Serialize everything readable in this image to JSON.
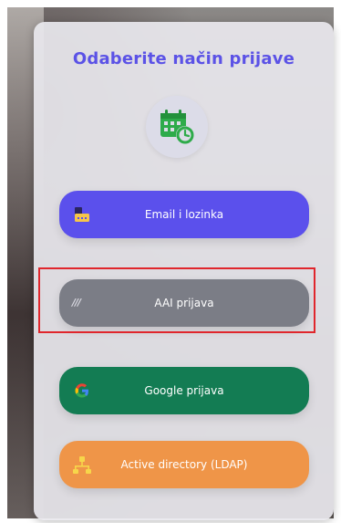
{
  "login": {
    "title": "Odaberite način prijave",
    "options": [
      {
        "id": "email",
        "label": "Email i lozinka",
        "icon": "envelope-lock-icon",
        "color": "#5b50ec"
      },
      {
        "id": "aai",
        "label": "AAI prijava",
        "icon": "aai-logo-icon",
        "color": "#7b7d86"
      },
      {
        "id": "google",
        "label": "Google prijava",
        "icon": "google-logo-icon",
        "color": "#137c53"
      },
      {
        "id": "ldap",
        "label": "Active directory (LDAP)",
        "icon": "network-tree-icon",
        "color": "#ef9548"
      }
    ]
  },
  "colors": {
    "title": "#5b52e6",
    "logo_green": "#2eab4a",
    "highlight": "#e0262c"
  }
}
